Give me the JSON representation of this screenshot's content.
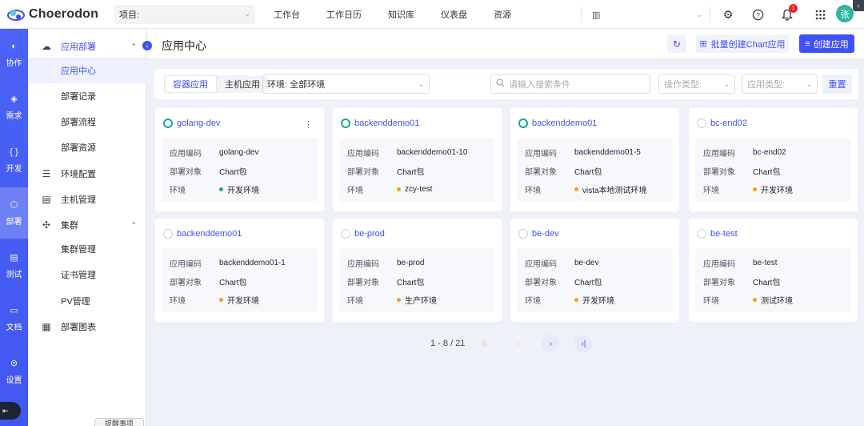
{
  "topbar": {
    "brand": "Choerodon",
    "project_label": "项目:",
    "nav": [
      "工作台",
      "工作日历",
      "知识库",
      "仪表盘",
      "资源"
    ],
    "notification_count": "1",
    "avatar_text": "张"
  },
  "rail": {
    "items": [
      {
        "label": "协作",
        "icon": "team-icon"
      },
      {
        "label": "需求",
        "icon": "layers-icon"
      },
      {
        "label": "开发",
        "icon": "code-icon"
      },
      {
        "label": "部署",
        "icon": "deploy-icon"
      },
      {
        "label": "测试",
        "icon": "test-icon"
      },
      {
        "label": "文档",
        "icon": "book-icon"
      },
      {
        "label": "设置",
        "icon": "settings-icon"
      }
    ],
    "active": "部署"
  },
  "submenu": {
    "group_deploy": "应用部署",
    "items": [
      "应用中心",
      "部署记录",
      "部署流程",
      "部署资源"
    ],
    "env_config": "环境配置",
    "host_mgmt": "主机管理",
    "group_cluster": "集群",
    "cluster_items": [
      "集群管理",
      "证书管理",
      "PV管理"
    ],
    "deploy_chart": "部署图表",
    "bottom_tab": "提醒事项"
  },
  "header": {
    "title": "应用中心",
    "batch_button": "批量创建Chart应用",
    "create_button": "创建应用"
  },
  "filters": {
    "tab_container": "容器应用",
    "tab_host": "主机应用",
    "env_select": "环境: 全部环境",
    "search_placeholder": "请输入搜索条件",
    "op_type_placeholder": "操作类型:",
    "app_type_placeholder": "应用类型:",
    "reset_button": "重置"
  },
  "card_labels": {
    "code": "应用编码",
    "target": "部署对象",
    "env": "环境"
  },
  "cards": [
    {
      "name": "golang-dev",
      "code": "golang-dev",
      "target": "Chart包",
      "env": "开发环境",
      "env_color": "#1fa58f",
      "status": "running",
      "has_menu": true
    },
    {
      "name": "backenddemo01",
      "code": "backenddemo01-10",
      "target": "Chart包",
      "env": "zcy-test",
      "env_color": "#f0a020",
      "status": "running"
    },
    {
      "name": "backenddemo01",
      "code": "backenddemo01-5",
      "target": "Chart包",
      "env": "vista本地测试环境",
      "env_color": "#f0a020",
      "status": "running"
    },
    {
      "name": "bc-end02",
      "code": "bc-end02",
      "target": "Chart包",
      "env": "开发环境",
      "env_color": "#f0a020",
      "status": "stopped"
    },
    {
      "name": "backenddemo01",
      "code": "backenddemo01-1",
      "target": "Chart包",
      "env": "开发环境",
      "env_color": "#f0a020",
      "status": "stopped"
    },
    {
      "name": "be-prod",
      "code": "be-prod",
      "target": "Chart包",
      "env": "生产环境",
      "env_color": "#f0a020",
      "status": "stopped"
    },
    {
      "name": "be-dev",
      "code": "be-dev",
      "target": "Chart包",
      "env": "开发环境",
      "env_color": "#f0a020",
      "status": "stopped"
    },
    {
      "name": "be-test",
      "code": "be-test",
      "target": "Chart包",
      "env": "测试环境",
      "env_color": "#f0a020",
      "status": "stopped"
    }
  ],
  "pagination": {
    "text": "1 - 8 / 21"
  }
}
